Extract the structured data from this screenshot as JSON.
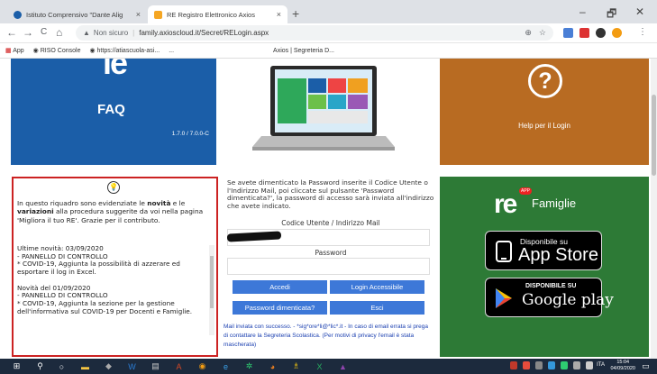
{
  "browser": {
    "tabs": [
      {
        "label": "Istituto Comprensivo \"Dante Alig",
        "close": "×"
      },
      {
        "label": "RE Registro Elettronico Axios",
        "close": "×"
      }
    ],
    "new_tab": "+",
    "window_controls": {
      "minimize": "–",
      "maximize": "🗗",
      "close": "✕"
    },
    "nav": {
      "back": "←",
      "forward": "→",
      "reload": "C",
      "home": "⌂"
    },
    "address": {
      "security": "Non sicuro",
      "url": "family.axioscloud.it/Secret/RELogin.aspx"
    },
    "bookmarks": [
      "App",
      "RISO Console",
      "https://atiascuola-asi...",
      "...",
      "Axios | Segreteria D..."
    ]
  },
  "page": {
    "faq": {
      "logo": "ie",
      "title": "FAQ",
      "version": "1.7.0 / 7.0.0-C"
    },
    "help": {
      "icon_text": "?",
      "label": "Help per il Login"
    },
    "info": {
      "intro_before": "In questo riquadro sono evidenziate le ",
      "intro_bold1": "novità",
      "intro_mid": " e le ",
      "intro_bold2": "variazioni",
      "intro_after": " alla procedura suggerite da voi nella pagina 'Migliora il tuo RE'. Grazie per il contributo.",
      "news": "Ultime novità: 03/09/2020\n- PANNELLO DI CONTROLLO\n  * COVID-19, Aggiunta la possibilità di azzerare ed esportare il log in Excel.\n\nNovità del 01/09/2020\n- PANNELLO DI CONTROLLO\n  * COVID-19, Aggiunta la sezione per la gestione dell'informativa sul COVID-19 per Docenti e Famiglie."
    },
    "login": {
      "description": "Se avete dimenticato la Password inserite il Codice Utente o l'Indirizzo Mail, poi cliccate sul pulsante 'Password dimenticata?', la password di accesso sarà inviata all'indirizzo che avete indicato.",
      "code_label": "Codice Utente / Indirizzo Mail",
      "code_value": "",
      "password_label": "Password",
      "password_value": "",
      "buttons": {
        "login": "Accedi",
        "accessible": "Login Accessibile",
        "forgot": "Password dimenticata?",
        "exit": "Esci"
      },
      "message": "Mail inviata con successo. - *sig*ore*li@*lic*.it - In caso di email errata si prega di contattare la Segreteria Scolastica. (Per motivi di privacy l'email è stata mascherata)"
    },
    "app": {
      "logo": "re",
      "badge": "APP",
      "title": "Famiglie",
      "appstore": {
        "small": "Disponibile su",
        "big": "App Store"
      },
      "googleplay": {
        "small": "DISPONIBILE SU",
        "big": "Google play"
      }
    }
  },
  "taskbar": {
    "language": "ITA",
    "time": "15:04",
    "date": "04/09/2020"
  },
  "colors": {
    "faq_blue": "#1b5ea8",
    "help_orange": "#b86b22",
    "app_green": "#2d7a36",
    "button_blue": "#3d78d8",
    "info_border": "#cc2222"
  }
}
